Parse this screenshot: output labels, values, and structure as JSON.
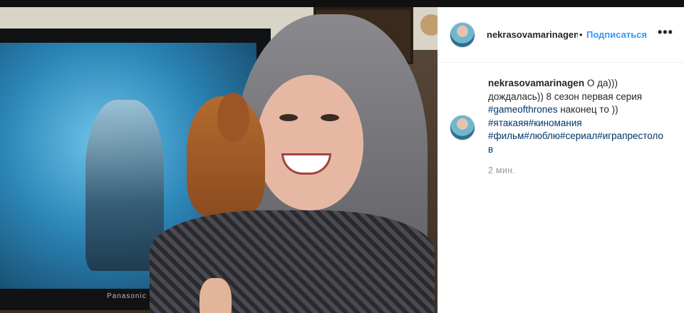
{
  "post": {
    "username": "nekrasovamarinagen",
    "dot": "•",
    "follow_label": "Подписаться",
    "more_label": "•••",
    "photo_brand": "Panasonic"
  },
  "caption": {
    "username": "nekrasovamarinagen",
    "text_part1": " О да))) дождалась)) 8 сезон первая серия ",
    "hashtag1": "#gameofthrones",
    "text_part2": " наконец то )) ",
    "hashtag2": "#ятакаяя",
    "hashtag3": "#киномания",
    "hashtag4": "#фильм",
    "hashtag5": "#люблю",
    "hashtag6": "#сериал",
    "hashtag7": "#играпрестолов",
    "timestamp": "2 мин."
  },
  "colors": {
    "link": "#3897f0",
    "hashtag": "#003569",
    "text": "#262626",
    "muted": "#999999"
  }
}
